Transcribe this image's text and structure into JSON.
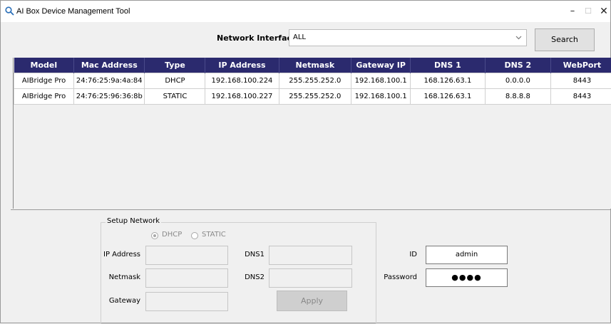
{
  "window": {
    "title": "AI Box Device Management Tool",
    "minimize": "–",
    "maximize": "☐",
    "close": "✕"
  },
  "toolbar": {
    "network_interface_label": "Network Interface :",
    "network_interface_value": "ALL",
    "search_label": "Search"
  },
  "table": {
    "columns": [
      "Model",
      "Mac Address",
      "Type",
      "IP Address",
      "Netmask",
      "Gateway IP",
      "DNS 1",
      "DNS 2",
      "WebPort"
    ],
    "rows": [
      [
        "AIBridge Pro",
        "24:76:25:9a:4a:84",
        "DHCP",
        "192.168.100.224",
        "255.255.252.0",
        "192.168.100.1",
        "168.126.63.1",
        "0.0.0.0",
        "8443"
      ],
      [
        "AIBridge Pro",
        "24:76:25:96:36:8b",
        "STATIC",
        "192.168.100.227",
        "255.255.252.0",
        "192.168.100.1",
        "168.126.63.1",
        "8.8.8.8",
        "8443"
      ]
    ]
  },
  "setup": {
    "legend": "Setup Network",
    "dhcp_label": "DHCP",
    "static_label": "STATIC",
    "ip_label": "IP Address",
    "netmask_label": "Netmask",
    "gateway_label": "Gateway",
    "dns1_label": "DNS1",
    "dns2_label": "DNS2",
    "apply_label": "Apply"
  },
  "auth": {
    "id_label": "ID",
    "id_value": "admin",
    "password_label": "Password",
    "password_value": "●●●●"
  },
  "colors": {
    "header_bg": "#2b2a6e",
    "window_bg": "#f0f0f0"
  },
  "icons": {
    "title": "magnifier-icon",
    "dropdown": "chevron-down-icon"
  }
}
